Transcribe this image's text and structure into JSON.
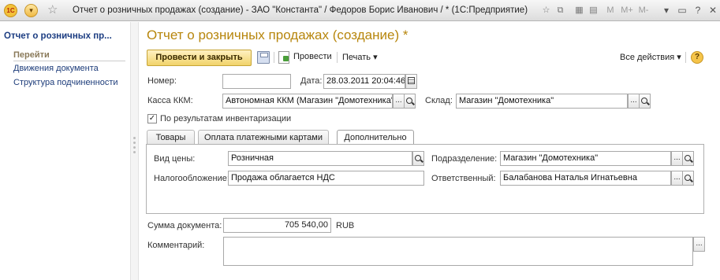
{
  "titlebar": {
    "title": "Отчет о розничных продажах (создание) - ЗАО \"Константа\" / Федоров Борис Иванович / * (1С:Предприятие)",
    "logo": "1С",
    "memory_buttons": [
      "M",
      "M+",
      "M-"
    ]
  },
  "sidebar": {
    "title": "Отчет о розничных пр...",
    "goto_header": "Перейти",
    "links": [
      "Движения документа",
      "Структура подчиненности"
    ]
  },
  "form": {
    "title": "Отчет о розничных продажах (создание) *",
    "post_close": "Провести и закрыть",
    "post": "Провести",
    "print": "Печать ▾",
    "all_actions": "Все действия ▾",
    "help": "?"
  },
  "fields": {
    "number_label": "Номер:",
    "number_value": "",
    "date_label": "Дата:",
    "date_value": "28.03.2011 20:04:46",
    "kassa_label": "Касса ККМ:",
    "kassa_value": "Автономная ККМ (Магазин \"Домотехника\")",
    "sklad_label": "Склад:",
    "sklad_value": "Магазин \"Домотехника\"",
    "inventory_label": "По результатам инвентаризации",
    "inventory_checked": true
  },
  "tabs": [
    "Товары",
    "Оплата платежными картами",
    "Дополнительно"
  ],
  "active_tab": 2,
  "extra": {
    "price_type_label": "Вид цены:",
    "price_type_value": "Розничная",
    "tax_label": "Налогообложение:",
    "tax_value": "Продажа облагается НДС",
    "department_label": "Подразделение:",
    "department_value": "Магазин \"Домотехника\"",
    "responsible_label": "Ответственный:",
    "responsible_value": "Балабанова Наталья Игнатьевна"
  },
  "totals": {
    "sum_label": "Сумма документа:",
    "sum_value": "705 540,00",
    "currency": "RUB",
    "comment_label": "Комментарий:",
    "comment_value": ""
  },
  "colors": {
    "title": "#b7860d",
    "link": "#1d3c7a",
    "primary_button": "#f1d36a"
  }
}
